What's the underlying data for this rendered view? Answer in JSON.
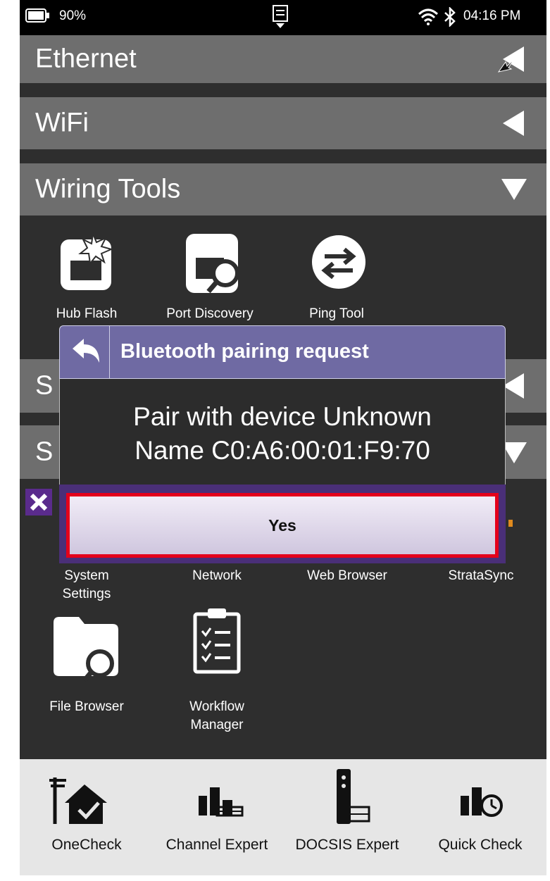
{
  "status_bar": {
    "battery": "90%",
    "time": "04:16 PM"
  },
  "sections": {
    "ethernet": "Ethernet",
    "wifi": "WiFi",
    "wiring_tools": "Wiring Tools",
    "partial_1": "S",
    "partial_2": "S"
  },
  "wiring_apps": [
    {
      "label": "Hub Flash",
      "icon": "hub-flash-icon"
    },
    {
      "label": "Port Discovery",
      "icon": "port-discovery-icon"
    },
    {
      "label": "Ping Tool",
      "icon": "ping-tool-icon"
    }
  ],
  "system_apps": {
    "system_settings_line1": "System",
    "system_settings_line2": "Settings",
    "network": "Network",
    "web_browser": "Web Browser",
    "stratasync": "StrataSync",
    "file_browser": "File Browser",
    "workflow_line1": "Workflow",
    "workflow_line2": "Manager"
  },
  "dialog": {
    "title": "Bluetooth pairing request",
    "message_line1": "Pair with device Unknown",
    "message_line2": "Name C0:A6:00:01:F9:70",
    "yes_label": "Yes"
  },
  "dock": [
    {
      "label": "OneCheck",
      "icon": "onecheck-icon"
    },
    {
      "label": "Channel Expert",
      "icon": "channel-expert-icon"
    },
    {
      "label": "DOCSIS Expert",
      "icon": "docsis-expert-icon"
    },
    {
      "label": "Quick Check",
      "icon": "quick-check-icon"
    }
  ],
  "colors": {
    "dialog_header": "#6f6aa3",
    "highlight": "#e4001b",
    "section_bar": "#6e6e6e"
  }
}
